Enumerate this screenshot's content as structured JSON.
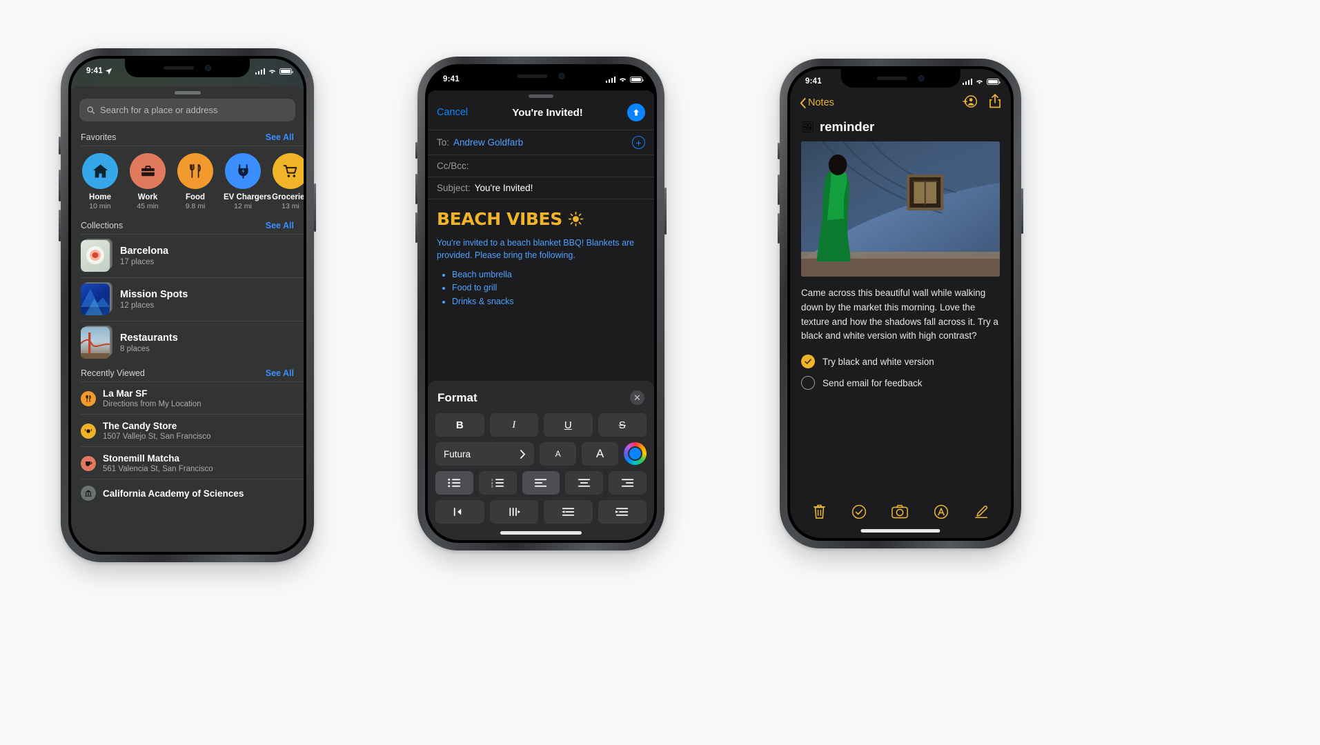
{
  "scene": {
    "background": "#f7f8f8",
    "device_count": 3
  },
  "maps": {
    "status": {
      "time": "9:41",
      "location_arrow": "location-arrow-icon"
    },
    "search": {
      "placeholder": "Search for a place or address",
      "icon": "search-icon"
    },
    "sections": {
      "favorites": {
        "label": "Favorites",
        "see_all": "See All"
      },
      "collections": {
        "label": "Collections",
        "see_all": "See All"
      },
      "recently_viewed": {
        "label": "Recently Viewed",
        "see_all": "See All"
      }
    },
    "favorites": [
      {
        "name": "Home",
        "detail": "10 min",
        "icon": "home-icon",
        "color": "#36a7e8"
      },
      {
        "name": "Work",
        "detail": "45 min",
        "icon": "briefcase-icon",
        "color": "#e07a5f"
      },
      {
        "name": "Food",
        "detail": "9.8 mi",
        "icon": "fork-knife-icon",
        "color": "#f29a2e"
      },
      {
        "name": "EV Chargers",
        "detail": "12 mi",
        "icon": "ev-plug-icon",
        "color": "#3c8dff"
      },
      {
        "name": "Groceries",
        "detail": "13 mi",
        "icon": "cart-icon",
        "color": "#f0b429"
      }
    ],
    "collections": [
      {
        "name": "Barcelona",
        "count": "17 places",
        "thumb": "food-plate-photo"
      },
      {
        "name": "Mission Spots",
        "count": "12 places",
        "thumb": "blue-abstract-photo"
      },
      {
        "name": "Restaurants",
        "count": "8 places",
        "thumb": "golden-gate-photo"
      }
    ],
    "recently_viewed": [
      {
        "name": "La Mar SF",
        "detail": "Directions from My Location",
        "icon": "fork-knife-icon",
        "color": "#f29a2e"
      },
      {
        "name": "The Candy Store",
        "detail": "1507 Vallejo St, San Francisco",
        "icon": "candy-icon",
        "color": "#f0b429"
      },
      {
        "name": "Stonemill Matcha",
        "detail": "561 Valencia St, San Francisco",
        "icon": "cafe-icon",
        "color": "#e07a5f"
      },
      {
        "name": "California Academy of Sciences",
        "detail": "",
        "icon": "museum-icon",
        "color": "#6d7170"
      }
    ]
  },
  "mail": {
    "status": {
      "time": "9:41"
    },
    "navbar": {
      "cancel": "Cancel",
      "title": "You're Invited!",
      "send_icon": "send-arrow-up-icon"
    },
    "fields": [
      {
        "label": "To:",
        "value": "Andrew Goldfarb",
        "style": "link",
        "trailing_icon": "add-contact-icon"
      },
      {
        "label": "Cc/Bcc:",
        "value": "",
        "style": "plain"
      },
      {
        "label": "Subject:",
        "value": "You're Invited!",
        "style": "plain"
      }
    ],
    "body": {
      "heading": "BEACH VIBES",
      "heading_icon": "sun-icon",
      "heading_color": "#f0b429",
      "paragraph": "You're invited to a beach blanket BBQ! Blankets are provided. Please bring the following.",
      "bullets": [
        "Beach umbrella",
        "Food to grill",
        "Drinks & snacks"
      ],
      "text_color": "#4da2ff"
    },
    "format_panel": {
      "title": "Format",
      "close_icon": "close-icon",
      "style_row": [
        {
          "label": "B",
          "name": "bold-button",
          "active": false
        },
        {
          "label": "I",
          "name": "italic-button",
          "active": false
        },
        {
          "label": "U",
          "name": "underline-button",
          "active": false
        },
        {
          "label": "S",
          "name": "strikethrough-button",
          "active": false
        }
      ],
      "font": {
        "name": "Futura",
        "chevron": "chevron-right-icon"
      },
      "size_small": "A",
      "size_large": "A",
      "color_wheel": {
        "name": "color-wheel",
        "selected": "#0a84ff"
      },
      "list_row": [
        {
          "icon": "bulleted-list-icon",
          "active": true
        },
        {
          "icon": "numbered-list-icon",
          "active": false
        },
        {
          "icon": "align-left-icon",
          "active": true
        },
        {
          "icon": "align-center-icon",
          "active": false
        },
        {
          "icon": "align-right-icon",
          "active": false
        }
      ],
      "indent_row": [
        {
          "icon": "outdent-icon"
        },
        {
          "icon": "indent-icon"
        },
        {
          "icon": "decrease-indent-icon"
        },
        {
          "icon": "increase-indent-icon"
        }
      ]
    }
  },
  "notes": {
    "status": {
      "time": "9:41"
    },
    "navbar": {
      "back_label": "Notes",
      "back_icon": "chevron-left-icon",
      "collaborate_icon": "add-people-icon",
      "share_icon": "share-icon",
      "accent": "#e8b43a"
    },
    "title": {
      "emoji": "🖼",
      "text": "reminder"
    },
    "photo": {
      "name": "blue-wall-woman-photo"
    },
    "body": "Came across this beautiful wall while walking down by the market this morning. Love the texture and how the shadows fall across it. Try a black and white version with high contrast?",
    "checklist": [
      {
        "text": "Try black and white version",
        "checked": true
      },
      {
        "text": "Send email for feedback",
        "checked": false
      }
    ],
    "toolbar": [
      {
        "icon": "trash-icon"
      },
      {
        "icon": "checklist-icon"
      },
      {
        "icon": "camera-icon"
      },
      {
        "icon": "markup-icon"
      },
      {
        "icon": "compose-icon"
      }
    ]
  }
}
